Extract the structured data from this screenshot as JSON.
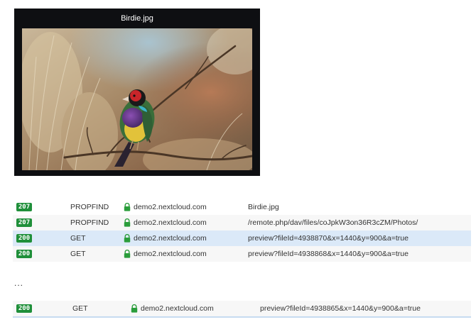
{
  "viewer": {
    "title": "Birdie.jpg"
  },
  "requests": [
    {
      "status": "207",
      "method": "PROPFIND",
      "host": "demo2.nextcloud.com",
      "file": "Birdie.jpg"
    },
    {
      "status": "207",
      "method": "PROPFIND",
      "host": "demo2.nextcloud.com",
      "file": "/remote.php/dav/files/coJpkW3on36R3cZM/Photos/"
    },
    {
      "status": "200",
      "method": "GET",
      "host": "demo2.nextcloud.com",
      "file": "preview?fileId=4938870&x=1440&y=900&a=true"
    },
    {
      "status": "200",
      "method": "GET",
      "host": "demo2.nextcloud.com",
      "file": "preview?fileId=4938868&x=1440&y=900&a=true"
    }
  ],
  "ellipsis": "...",
  "last_request": {
    "status": "200",
    "method": "GET",
    "host": "demo2.nextcloud.com",
    "file": "preview?fileId=4938865&x=1440&y=900&a=true"
  },
  "colors": {
    "status_ok": "#1f8f3a",
    "row_selected": "#dbe9f8",
    "row_alt": "#f7f7f7",
    "viewer_bg": "#0e0f12"
  },
  "icons": {
    "secure": "lock-icon"
  }
}
